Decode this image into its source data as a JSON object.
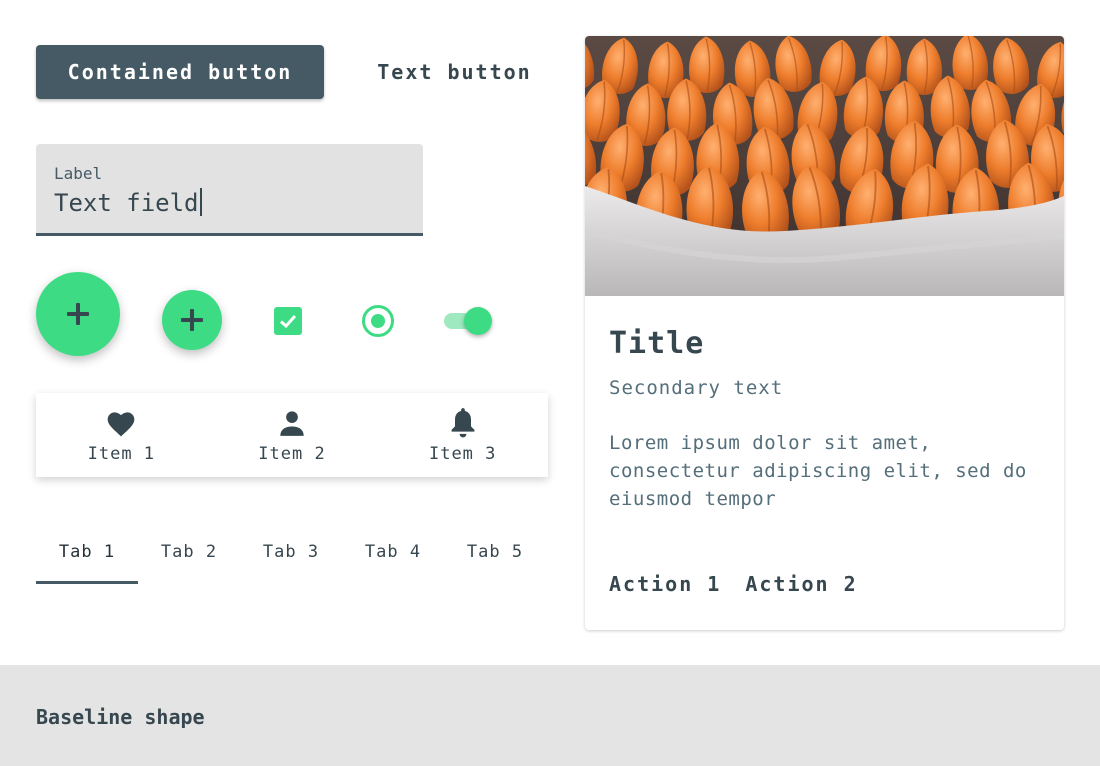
{
  "buttons": {
    "contained_label": "Contained button",
    "text_label": "Text button"
  },
  "text_field": {
    "label": "Label",
    "value": "Text field"
  },
  "controls": {
    "checkbox_checked": true,
    "radio_selected": true,
    "switch_on": true
  },
  "bottom_nav": {
    "items": [
      {
        "label": "Item 1",
        "icon": "heart-icon"
      },
      {
        "label": "Item 2",
        "icon": "person-icon"
      },
      {
        "label": "Item 3",
        "icon": "bell-icon"
      }
    ]
  },
  "tabs": {
    "items": [
      {
        "label": "Tab 1",
        "active": true
      },
      {
        "label": "Tab 2",
        "active": false
      },
      {
        "label": "Tab 3",
        "active": false
      },
      {
        "label": "Tab 4",
        "active": false
      },
      {
        "label": "Tab 5",
        "active": false
      }
    ]
  },
  "card": {
    "title": "Title",
    "secondary": "Secondary text",
    "body": "Lorem ipsum dolor sit amet, consectetur adipiscing elit, sed do eiusmod tempor",
    "actions": [
      "Action 1",
      "Action 2"
    ],
    "media": "tulips-image"
  },
  "footer": {
    "label": "Baseline shape"
  },
  "colors": {
    "primary": "#455a64",
    "secondary": "#3ddc84",
    "text": "#37474f",
    "field_bg": "#e2e2e2",
    "footer_bg": "#e4e4e4"
  }
}
